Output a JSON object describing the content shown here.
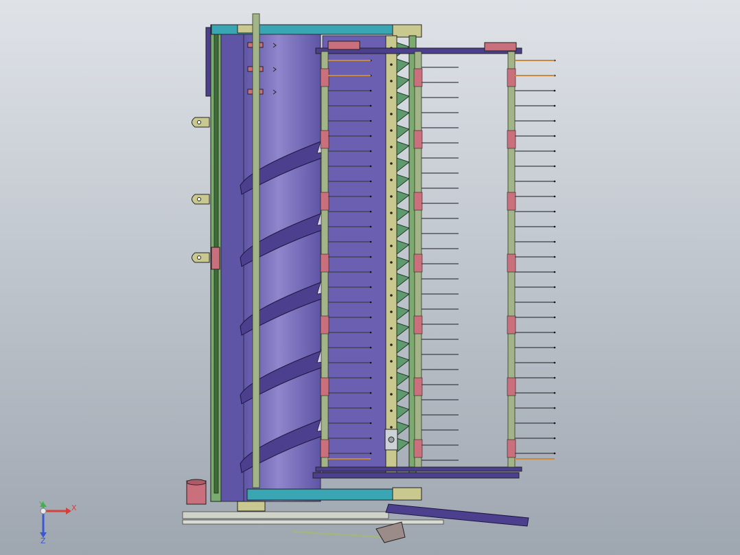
{
  "colors": {
    "background_top": "#dfe3e8",
    "background_bottom": "#9ea6b0",
    "frame_green": "#7cab6f",
    "frame_green_dark": "#3f6a3a",
    "auger_drum": "#8f86cc",
    "auger_drum_dark": "#5f55a6",
    "auger_flight": "#4c3f8e",
    "cutter_bed": "#6a5fb0",
    "pipe_tan": "#a3b489",
    "pipe_pink": "#c9707c",
    "knife_green": "#5f9a6e",
    "rail_teal": "#3aa6b3",
    "bracket_olive": "#c9c98f",
    "tine_metal": "#3b3f46",
    "axis_x": "#d6403a",
    "axis_y": "#3fb34a",
    "axis_z": "#3a58d6"
  },
  "triad": {
    "x_label": "X",
    "y_label": "Y",
    "z_label": "Z"
  }
}
